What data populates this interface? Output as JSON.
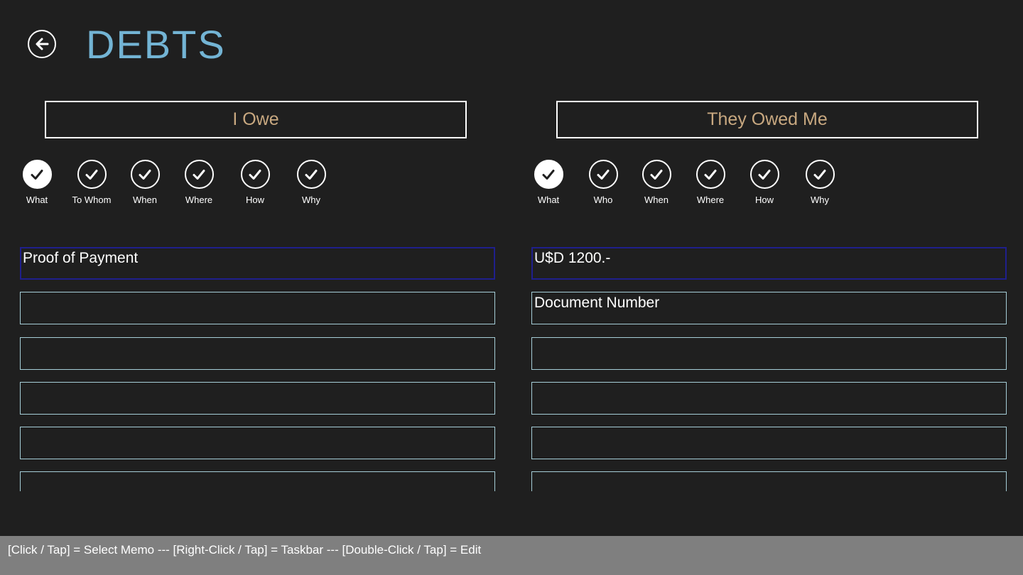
{
  "header": {
    "title": "DEBTS",
    "back_icon": "arrow-left-icon"
  },
  "colors": {
    "background": "#1f1f1f",
    "title": "#73b4d4",
    "tab_text": "#c8a880",
    "field_border": "#a6ced8",
    "active_field_border": "#1f1f8c",
    "status_bar": "#7f7f7f"
  },
  "left": {
    "header": "I Owe",
    "checks": [
      {
        "label": "What",
        "selected": true
      },
      {
        "label": "To Whom",
        "selected": false
      },
      {
        "label": "When",
        "selected": false
      },
      {
        "label": "Where",
        "selected": false
      },
      {
        "label": "How",
        "selected": false
      },
      {
        "label": "Why",
        "selected": false
      }
    ],
    "fields": [
      "Proof of Payment",
      "",
      "",
      "",
      "",
      ""
    ]
  },
  "right": {
    "header": "They Owed Me",
    "checks": [
      {
        "label": "What",
        "selected": true
      },
      {
        "label": "Who",
        "selected": false
      },
      {
        "label": "When",
        "selected": false
      },
      {
        "label": "Where",
        "selected": false
      },
      {
        "label": "How",
        "selected": false
      },
      {
        "label": "Why",
        "selected": false
      }
    ],
    "fields": [
      "U$D 1200.-",
      "Document Number",
      "",
      "",
      "",
      ""
    ]
  },
  "status_bar": {
    "text": "[Click / Tap] = Select Memo --- [Right-Click / Tap] = Taskbar --- [Double-Click / Tap] = Edit"
  }
}
